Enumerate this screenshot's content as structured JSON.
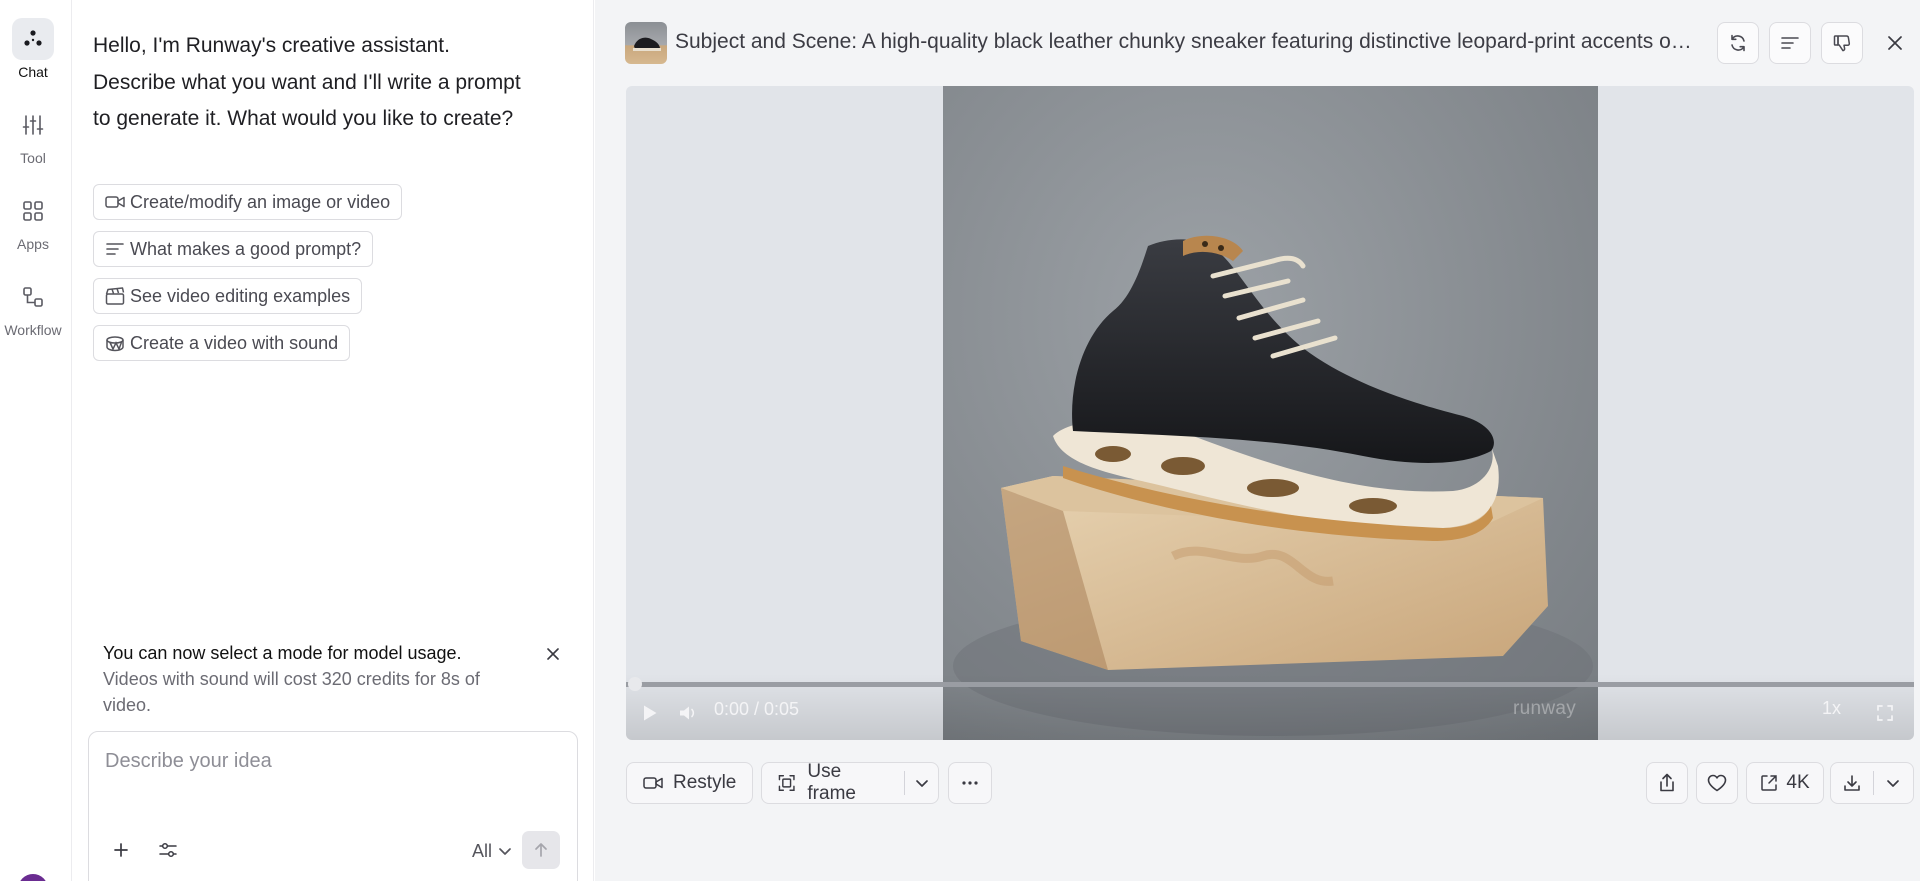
{
  "rail": {
    "items": [
      {
        "label": "Chat"
      },
      {
        "label": "Tool"
      },
      {
        "label": "Apps"
      },
      {
        "label": "Workflow"
      }
    ]
  },
  "chat": {
    "greeting": "Hello, I'm Runway's creative assistant. Describe what you want and I'll write a prompt to generate it. What would you like to create?",
    "suggestions": [
      {
        "label": "Create/modify an image or video",
        "icon": "video-camera-icon"
      },
      {
        "label": "What makes a good prompt?",
        "icon": "lines-icon"
      },
      {
        "label": "See video editing examples",
        "icon": "clapperboard-icon"
      },
      {
        "label": "Create a video with sound",
        "icon": "drum-icon"
      }
    ],
    "notice": {
      "title": "You can now select a mode for model usage.",
      "body": "Videos with sound will cost 320 credits for 8s of video."
    },
    "composer": {
      "placeholder": "Describe your idea",
      "mode": "All"
    }
  },
  "preview": {
    "title": "Subject and Scene: A high-quality black leather chunky sneaker featuring distinctive leopard-print accents on the tongue and midsole",
    "player": {
      "time": "0:00 / 0:05",
      "watermark": "runway",
      "speed": "1x",
      "progress": 0
    },
    "toolbar": {
      "restyle": "Restyle",
      "use_frame": "Use frame",
      "upscale": "4K"
    }
  },
  "colors": {
    "accent_avatar": "#6a2c91",
    "panel_bg": "#f3f4f6"
  }
}
